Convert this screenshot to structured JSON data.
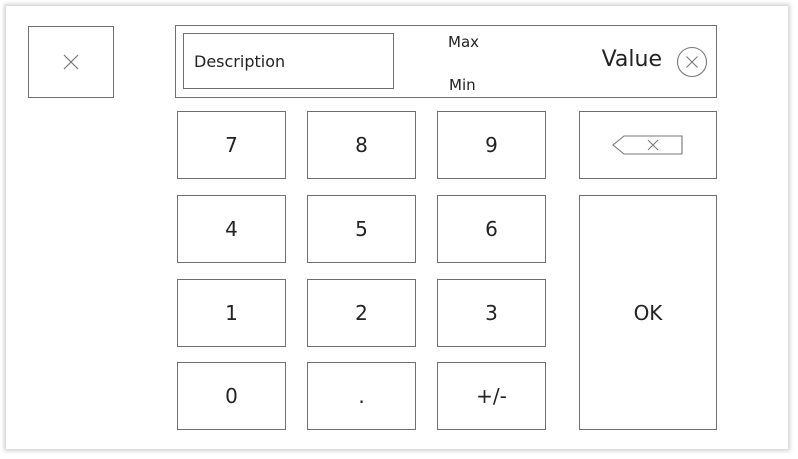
{
  "dialog": {
    "close_icon": "close-icon"
  },
  "display": {
    "description": "Description",
    "max_label": "Max",
    "min_label": "Min",
    "value_label": "Value",
    "clear_icon": "circle-x-icon"
  },
  "keypad": {
    "keys": {
      "seven": "7",
      "eight": "8",
      "nine": "9",
      "four": "4",
      "five": "5",
      "six": "6",
      "one": "1",
      "two": "2",
      "three": "3",
      "zero": "0",
      "dot": ".",
      "sign": "+/-"
    },
    "backspace_icon": "backspace-icon",
    "ok_label": "OK"
  },
  "colors": {
    "border": "#6f6f6f",
    "text": "#222222",
    "background": "#ffffff"
  }
}
